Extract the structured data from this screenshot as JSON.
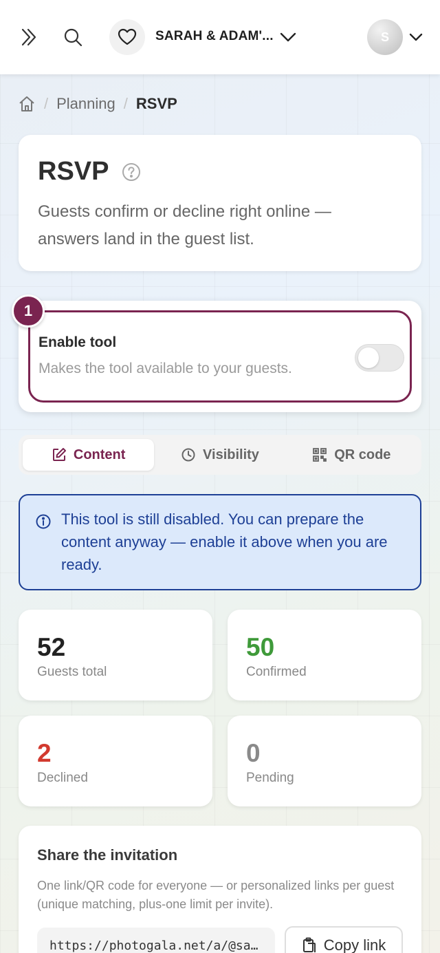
{
  "header": {
    "event_name": "SARAH & ADAM'...",
    "avatar_initial": "S"
  },
  "breadcrumb": {
    "level1": "Planning",
    "current": "RSVP"
  },
  "page": {
    "title": "RSVP",
    "description": "Guests confirm or decline right online — answers land in the guest list."
  },
  "enable_tool": {
    "step": "1",
    "title": "Enable tool",
    "subtitle": "Makes the tool available to your guests.",
    "enabled": false
  },
  "tabs": [
    {
      "label": "Content",
      "icon": "edit-icon",
      "active": true
    },
    {
      "label": "Visibility",
      "icon": "clock-icon",
      "active": false
    },
    {
      "label": "QR code",
      "icon": "qr-code-icon",
      "active": false
    }
  ],
  "info": {
    "text": "This tool is still disabled. You can prepare the content anyway — enable it above when you are ready."
  },
  "stats": [
    {
      "value": "52",
      "label": "Guests total",
      "color": "#222222"
    },
    {
      "value": "50",
      "label": "Confirmed",
      "color": "#3f9a3a"
    },
    {
      "value": "2",
      "label": "Declined",
      "color": "#d23a2f"
    },
    {
      "value": "0",
      "label": "Pending",
      "color": "#8a8a8a"
    }
  ],
  "share": {
    "title": "Share the invitation",
    "description": "One link/QR code for everyone — or personalized links per guest (unique matching, plus-one limit per invite).",
    "link": "https://photogala.net/a/@sa…",
    "copy_label": "Copy link"
  },
  "colors": {
    "accent": "#7a2450",
    "info_blue": "#1d3f95",
    "info_bg": "#dce9fb"
  }
}
